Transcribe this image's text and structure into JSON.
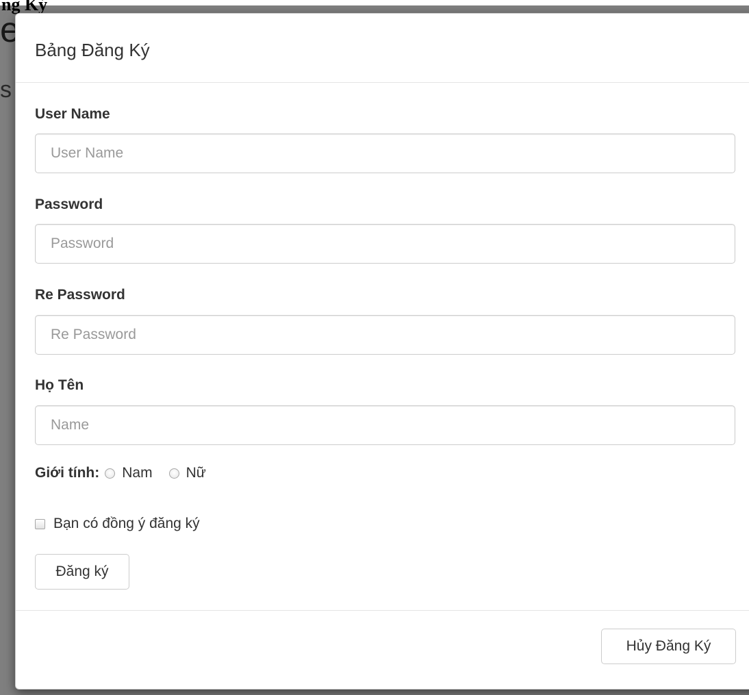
{
  "background": {
    "title": "ng Ký",
    "big_letter": "e",
    "small_letter": "s"
  },
  "modal": {
    "title": "Bảng Đăng Ký",
    "fields": [
      {
        "label": "User Name",
        "placeholder": "User Name",
        "value": ""
      },
      {
        "label": "Password",
        "placeholder": "Password",
        "value": ""
      },
      {
        "label": "Re Password",
        "placeholder": "Re Password",
        "value": ""
      },
      {
        "label": "Họ Tên",
        "placeholder": "Name",
        "value": ""
      }
    ],
    "gender": {
      "label": "Giới tính:",
      "options": [
        "Nam",
        "Nữ"
      ],
      "selected": ""
    },
    "agree": {
      "label": "Bạn có đồng ý đăng ký",
      "checked": false
    },
    "submit_label": "Đăng ký",
    "cancel_label": "Hủy Đăng Ký"
  }
}
